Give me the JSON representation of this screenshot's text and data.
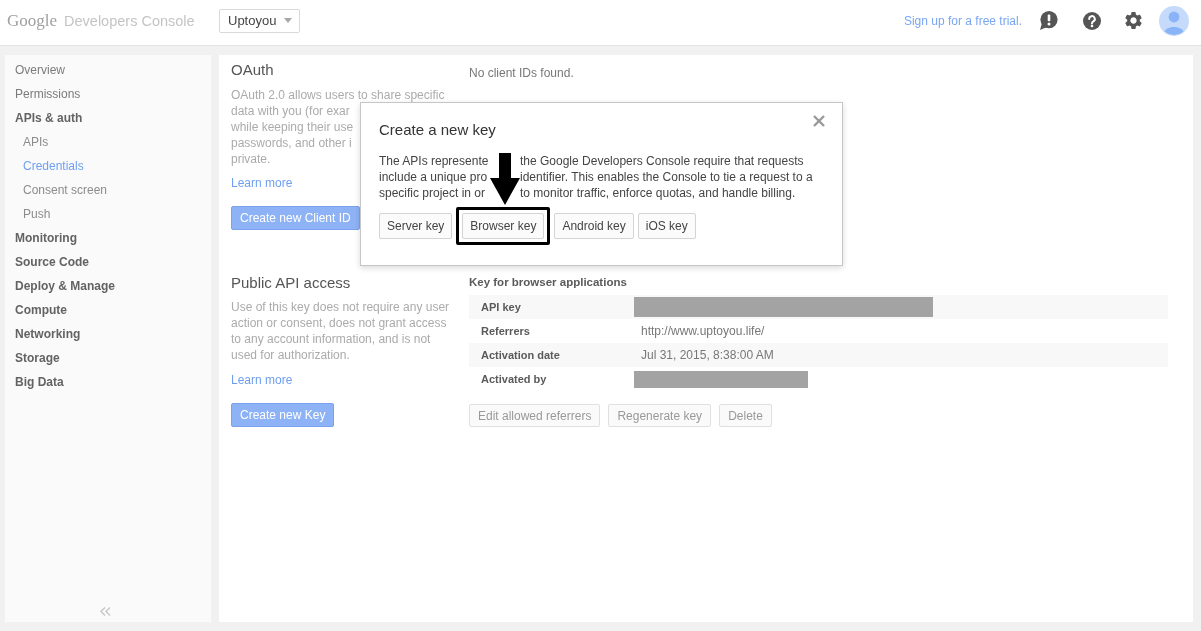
{
  "header": {
    "logo": "Google",
    "product": "Developers Console",
    "project": "Uptoyou",
    "trial_link": "Sign up for a free trial."
  },
  "sidebar": {
    "items": [
      {
        "label": "Overview",
        "kind": "page",
        "selected": false
      },
      {
        "label": "Permissions",
        "kind": "page",
        "selected": false
      },
      {
        "label": "APIs & auth",
        "kind": "group",
        "selected": false,
        "children": [
          {
            "label": "APIs",
            "selected": false
          },
          {
            "label": "Credentials",
            "selected": true
          },
          {
            "label": "Consent screen",
            "selected": false
          },
          {
            "label": "Push",
            "selected": false
          }
        ]
      },
      {
        "label": "Monitoring",
        "kind": "group",
        "selected": false
      },
      {
        "label": "Source Code",
        "kind": "group",
        "selected": false
      },
      {
        "label": "Deploy & Manage",
        "kind": "group",
        "selected": false
      },
      {
        "label": "Compute",
        "kind": "group",
        "selected": false
      },
      {
        "label": "Networking",
        "kind": "group",
        "selected": false
      },
      {
        "label": "Storage",
        "kind": "group",
        "selected": false
      },
      {
        "label": "Big Data",
        "kind": "group",
        "selected": false
      }
    ]
  },
  "oauth": {
    "title": "OAuth",
    "description_lines": [
      "OAuth 2.0 allows users to share specific",
      "data with you (for exar",
      "while keeping their use",
      "passwords, and other i",
      "private."
    ],
    "link": "Learn more",
    "button": "Create new Client ID",
    "status": "No client IDs found."
  },
  "public_api": {
    "title": "Public API access",
    "description": "Use of this key does not require any user action or consent, does not grant access to any account information, and is not used for authorization.",
    "link": "Learn more",
    "button": "Create new Key",
    "key_title": "Key for browser applications",
    "rows": [
      {
        "label": "API key",
        "kind": "redacted"
      },
      {
        "label": "Referrers",
        "kind": "text",
        "value": "http://www.uptoyou.life/"
      },
      {
        "label": "Activation date",
        "kind": "text",
        "value": "Jul 31, 2015, 8:38:00 AM"
      },
      {
        "label": "Activated by",
        "kind": "redacted"
      }
    ],
    "actions": [
      "Edit allowed referrers",
      "Regenerate key",
      "Delete"
    ]
  },
  "dialog": {
    "title": "Create a new key",
    "lines": [
      {
        "before": "The APIs represente",
        "after": "the Google Developers Console require that requests"
      },
      {
        "before": "include a unique pro",
        "after": "identifier. This enables the Console to tie a request to a"
      },
      {
        "before": "specific project in or",
        "after": "to monitor traffic, enforce quotas, and handle billing."
      }
    ],
    "buttons": [
      {
        "label": "Server key",
        "highlighted": false
      },
      {
        "label": "Browser key",
        "highlighted": true
      },
      {
        "label": "Android key",
        "highlighted": false
      },
      {
        "label": "iOS key",
        "highlighted": false
      }
    ]
  }
}
